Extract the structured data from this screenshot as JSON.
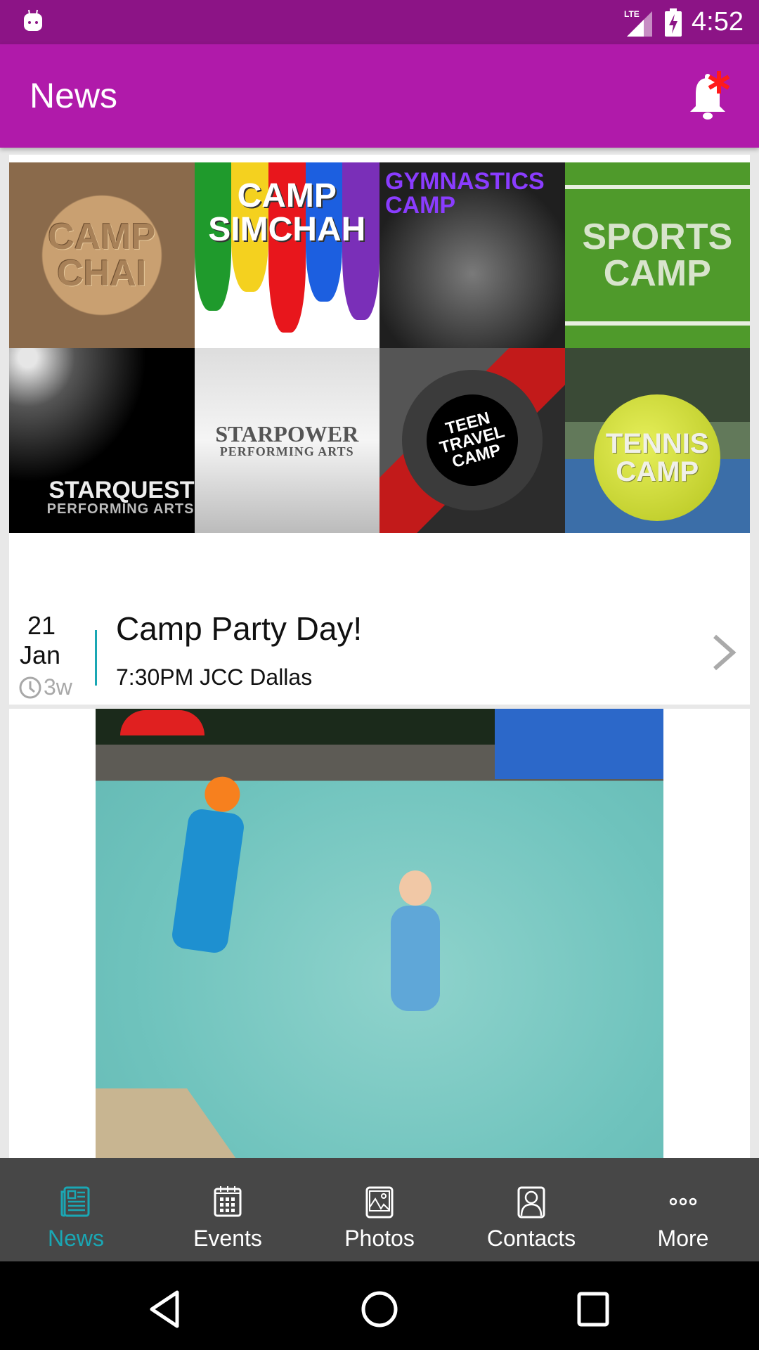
{
  "status_bar": {
    "time": "4:52",
    "network": "LTE",
    "icons": [
      "android-icon",
      "lte-signal-icon",
      "battery-charging-icon"
    ]
  },
  "app_bar": {
    "title": "News",
    "notification_icon": "bell-with-red-asterisk-icon"
  },
  "feed": [
    {
      "type": "event",
      "image_tiles": [
        {
          "line1": "CAMP",
          "line2": "CHAI"
        },
        {
          "line1": "CAMP",
          "line2": "SIMCHAH"
        },
        {
          "line1": "GYMNASTICS",
          "line2": "CAMP"
        },
        {
          "line1": "SPORTS",
          "line2": "CAMP"
        },
        {
          "line1": "STARQUEST",
          "line2": "PERFORMING ARTS"
        },
        {
          "line1": "STARPOWER",
          "line2": "PERFORMING ARTS"
        },
        {
          "line1": "TEEN",
          "line2": "TRAVEL",
          "line3": "CAMP"
        },
        {
          "line1": "TENNIS",
          "line2": "CAMP"
        }
      ],
      "date_day": "21",
      "date_month": "Jan",
      "age": "3w",
      "title": "Camp Party Day!",
      "subtitle": "7:30PM JCC Dallas"
    },
    {
      "type": "photo",
      "description": "Kids at swimming pool"
    }
  ],
  "bottom_nav": {
    "items": [
      {
        "label": "News",
        "icon": "newspaper-icon",
        "active": true
      },
      {
        "label": "Events",
        "icon": "calendar-icon",
        "active": false
      },
      {
        "label": "Photos",
        "icon": "photo-icon",
        "active": false
      },
      {
        "label": "Contacts",
        "icon": "contact-icon",
        "active": false
      },
      {
        "label": "More",
        "icon": "more-dots-icon",
        "active": false
      }
    ]
  },
  "colors": {
    "status_bar": "#8c1486",
    "app_bar": "#b01aaa",
    "accent": "#1aa7b4",
    "nav_bg": "#474747",
    "notification_badge": "#ff1a1a"
  }
}
